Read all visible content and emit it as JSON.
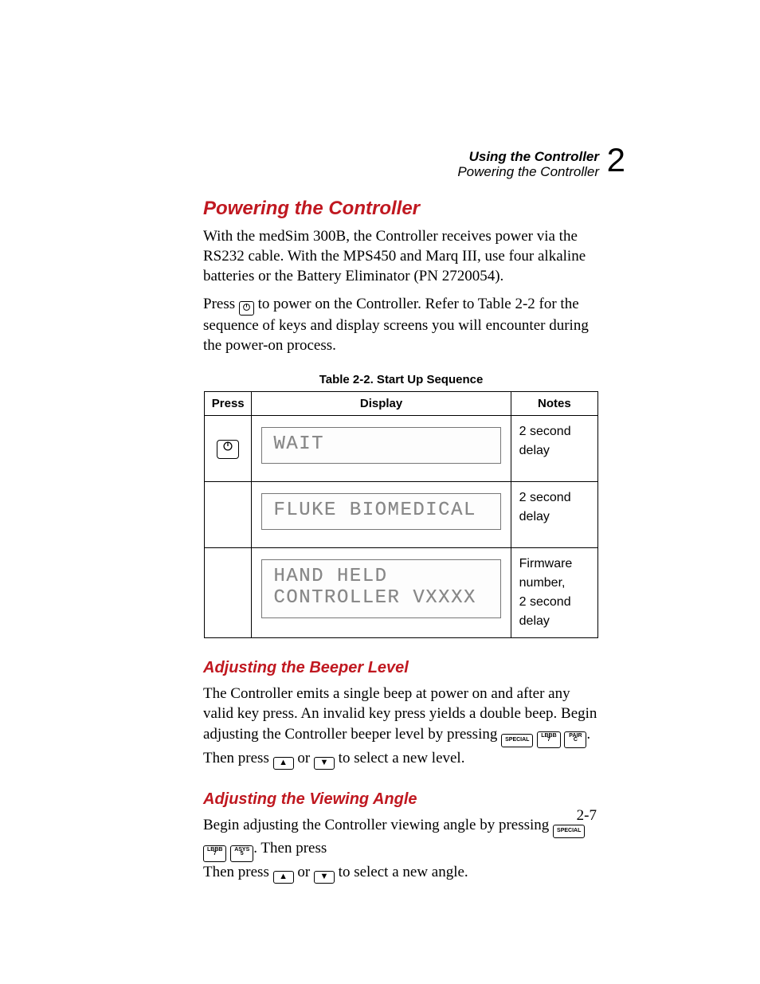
{
  "header": {
    "line1": "Using the Controller",
    "line2": "Powering the Controller",
    "chapter_number": "2"
  },
  "section_title": "Powering the Controller",
  "para1": "With the medSim 300B, the Controller receives power via the RS232 cable. With the MPS450 and Marq III, use four alkaline batteries or the Battery Eliminator (PN 2720054).",
  "para2a": "Press ",
  "para2b": " to power on the Controller. Refer to Table 2-2 for the sequence of keys and display screens you will encounter during the power-on process.",
  "table": {
    "caption": "Table 2-2. Start Up Sequence",
    "headers": {
      "press": "Press",
      "display": "Display",
      "notes": "Notes"
    },
    "rows": [
      {
        "press_icon": "power",
        "display_lines": [
          "WAIT"
        ],
        "notes": "2 second delay"
      },
      {
        "press_icon": "",
        "display_lines": [
          "FLUKE BIOMEDICAL"
        ],
        "notes": "2 second delay"
      },
      {
        "press_icon": "",
        "display_lines": [
          "HAND HELD",
          "CONTROLLER VXXXX"
        ],
        "notes": "Firmware number,\n2 second delay"
      }
    ]
  },
  "sub1": {
    "title": "Adjusting the Beeper Level",
    "text_a": "The Controller emits a single beep at power on and after any valid key press. An invalid key press yields a double beep. Begin adjusting the Controller beeper level by pressing ",
    "keys1": [
      "SPECIAL",
      "LBBB|7",
      "PAIR|C"
    ],
    "text_b": ". Then press ",
    "text_c": " or ",
    "text_d": " to select a new level."
  },
  "sub2": {
    "title": "Adjusting the Viewing Angle",
    "text_a": "Begin adjusting the Controller viewing angle by pressing ",
    "keys1": [
      "SPECIAL",
      "LBBB|7",
      "ASYS|5"
    ],
    "text_b": ". Then press ",
    "text_c": " or ",
    "text_d": " to select a new angle."
  },
  "page_number": "2-7",
  "arrows": {
    "up": "▲",
    "down": "▼"
  },
  "chart_data": {
    "type": "table",
    "title": "Table 2-2. Start Up Sequence",
    "columns": [
      "Press",
      "Display",
      "Notes"
    ],
    "rows": [
      [
        "(power key)",
        "WAIT",
        "2 second delay"
      ],
      [
        "",
        "FLUKE BIOMEDICAL",
        "2 second delay"
      ],
      [
        "",
        "HAND HELD / CONTROLLER VXXXX",
        "Firmware number, 2 second delay"
      ]
    ]
  }
}
